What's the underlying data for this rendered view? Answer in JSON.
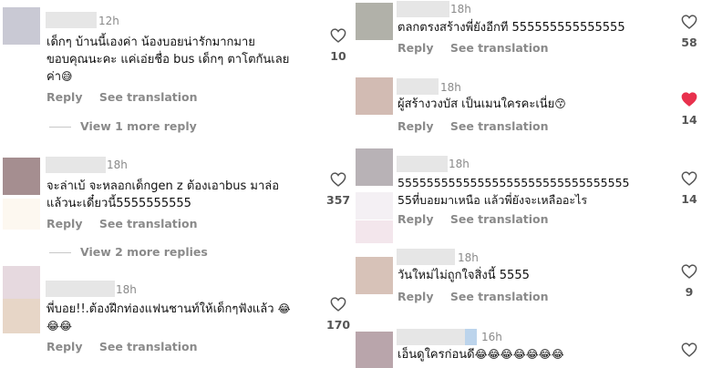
{
  "left": {
    "c1": {
      "time": "12h",
      "text": "เด็กๆ บ้านนี้เองค่า น้องบอยน่ารักมากมาย\nขอบคุณนะคะ แค่เอ่ยชื่อ bus เด็กๆ ตาโตกันเลย\nค่า",
      "emoji": "😅",
      "reply": "Reply",
      "translate": "See translation",
      "likes": "10"
    },
    "more1": "View 1 more reply",
    "c2": {
      "time": "18h",
      "text": "จะล่าเบ้ จะหลอกเด็กgen z ต้องเอาbus มาล่อ\nแล้วนะเดี๋ยวนี้5555555555",
      "reply": "Reply",
      "translate": "See translation",
      "likes": "357"
    },
    "more2": "View 2 more replies",
    "c3": {
      "time": "18h",
      "text": "พี่บอย!!.ต้องฝึกท่องแฟนชานท์ให้เด็กๆฟังแล้ว ",
      "emoji_a": "😂",
      "emoji_b": "😂😂",
      "reply": "Reply",
      "translate": "See translation",
      "likes": "170"
    }
  },
  "right": {
    "c1": {
      "time": "18h",
      "text": "ตลกตรงสร้างพี่ยังอีกที 555555555555555",
      "reply": "Reply",
      "translate": "See translation",
      "likes": "58"
    },
    "c2": {
      "time": "18h",
      "text": "ผู้สร้างวงบัส เป็นเมนใครคะเนี่ย",
      "emoji": "😙",
      "reply": "Reply",
      "translate": "See translation",
      "likes": "14"
    },
    "c3": {
      "time": "18h",
      "text": "55555555555555555555555555555555\n55ที่บอยมาเหนือ แล้วพี่ยังจะเหลืออะไร",
      "reply": "Reply",
      "translate": "See translation",
      "likes": "14"
    },
    "c4": {
      "time": "18h",
      "text": "วันใหม่ไม่ถูกใจสิ่งนี้ 5555",
      "reply": "Reply",
      "translate": "See translation",
      "likes": "9"
    },
    "c5": {
      "time": "16h",
      "text": "เอ็นดูใครก่อนดี",
      "emoji": "😂😂😂😂😂😂😂"
    }
  },
  "icons": {
    "like": "heart-outline-icon",
    "liked": "heart-filled-icon"
  },
  "colors": {
    "liked": "#e8314d",
    "muted": "#8a8a8a"
  }
}
